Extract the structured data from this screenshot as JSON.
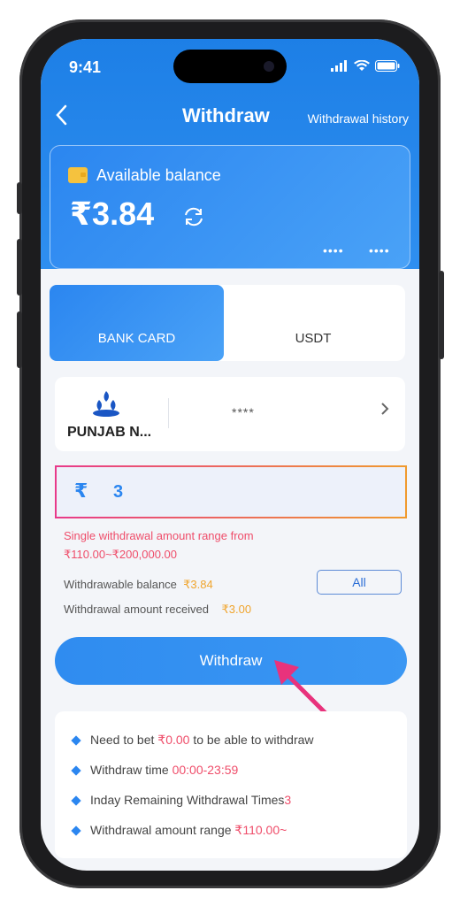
{
  "status": {
    "time": "9:41"
  },
  "header": {
    "title": "Withdraw",
    "history_label": "Withdrawal history"
  },
  "balance": {
    "label": "Available balance",
    "amount": "₹3.84",
    "masked_left": "••••",
    "masked_right": "••••"
  },
  "tabs": [
    {
      "label": "BANK CARD",
      "active": true
    },
    {
      "label": "USDT",
      "active": false
    }
  ],
  "bank": {
    "name": "PUNJAB N...",
    "account_masked": "****"
  },
  "amount_input": {
    "currency_symbol": "₹",
    "value": "3"
  },
  "range_notice": {
    "line1": "Single withdrawal amount range from",
    "line2": "₹110.00~₹200,000.00"
  },
  "withdrawable": {
    "label": "Withdrawable balance",
    "value": "₹3.84",
    "all_label": "All"
  },
  "received": {
    "label": "Withdrawal amount received",
    "value": "₹3.00"
  },
  "withdraw_button": {
    "label": "Withdraw"
  },
  "info": {
    "bet_prefix": "Need to bet ",
    "bet_value": "₹0.00",
    "bet_suffix": " to be able to withdraw",
    "time_prefix": "Withdraw time ",
    "time_value": "00:00-23:59",
    "remaining_prefix": "Inday Remaining Withdrawal Times",
    "remaining_value": "3",
    "range_prefix": "Withdrawal amount range ",
    "range_value": "₹110.00~"
  },
  "colors": {
    "primary": "#2b86f0",
    "accent_pink": "#ef4d6a",
    "accent_orange": "#f0a52e"
  },
  "icons": {
    "back": "chevron-left-icon",
    "wallet": "wallet-icon",
    "refresh": "refresh-icon",
    "chevron": "chevron-right-icon",
    "bank_logo": "flame-logo-icon"
  }
}
